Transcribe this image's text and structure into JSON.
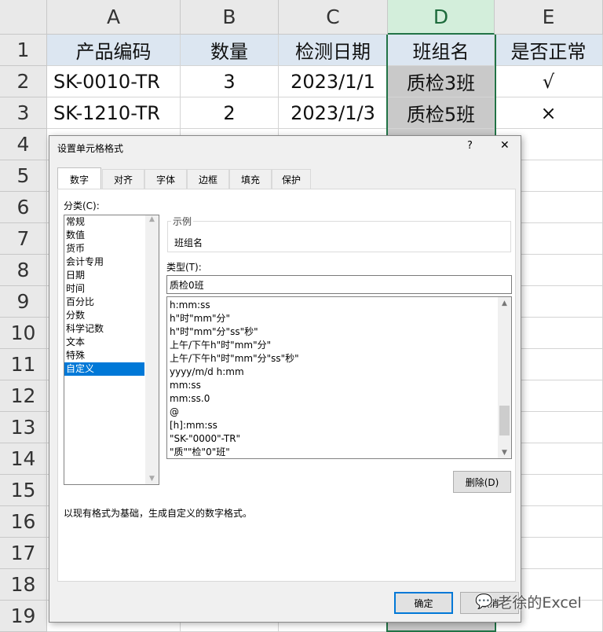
{
  "columns": [
    "A",
    "B",
    "C",
    "D",
    "E"
  ],
  "rows": [
    "1",
    "2",
    "3",
    "4",
    "5",
    "6",
    "7",
    "8",
    "9",
    "10",
    "11",
    "12",
    "13",
    "14",
    "15",
    "16",
    "17",
    "18",
    "19"
  ],
  "table": {
    "headers": [
      "产品编码",
      "数量",
      "检测日期",
      "班组名",
      "是否正常"
    ],
    "data": [
      [
        "SK-0010-TR",
        "3",
        "2023/1/1",
        "质检3班",
        "√"
      ],
      [
        "SK-1210-TR",
        "2",
        "2023/1/3",
        "质检5班",
        "×"
      ]
    ]
  },
  "dialog": {
    "title": "设置单元格格式",
    "help": "?",
    "close": "✕",
    "tabs": [
      "数字",
      "对齐",
      "字体",
      "边框",
      "填充",
      "保护"
    ],
    "category_label": "分类(C):",
    "categories": [
      "常规",
      "数值",
      "货币",
      "会计专用",
      "日期",
      "时间",
      "百分比",
      "分数",
      "科学记数",
      "文本",
      "特殊",
      "自定义"
    ],
    "selected_category": "自定义",
    "sample_label": "示例",
    "sample_value": "班组名",
    "type_label": "类型(T):",
    "type_value": "质检0班",
    "formats": [
      "h:mm:ss",
      "h\"时\"mm\"分\"",
      "h\"时\"mm\"分\"ss\"秒\"",
      "上午/下午h\"时\"mm\"分\"",
      "上午/下午h\"时\"mm\"分\"ss\"秒\"",
      "yyyy/m/d h:mm",
      "mm:ss",
      "mm:ss.0",
      "@",
      "[h]:mm:ss",
      "\"SK-\"0000\"-TR\"",
      "\"质\"\"检\"0\"班\""
    ],
    "delete_label": "删除(D)",
    "description": "以现有格式为基础，生成自定义的数字格式。",
    "ok_label": "确定",
    "cancel_label": "取消"
  },
  "watermark": "老徐的Excel"
}
